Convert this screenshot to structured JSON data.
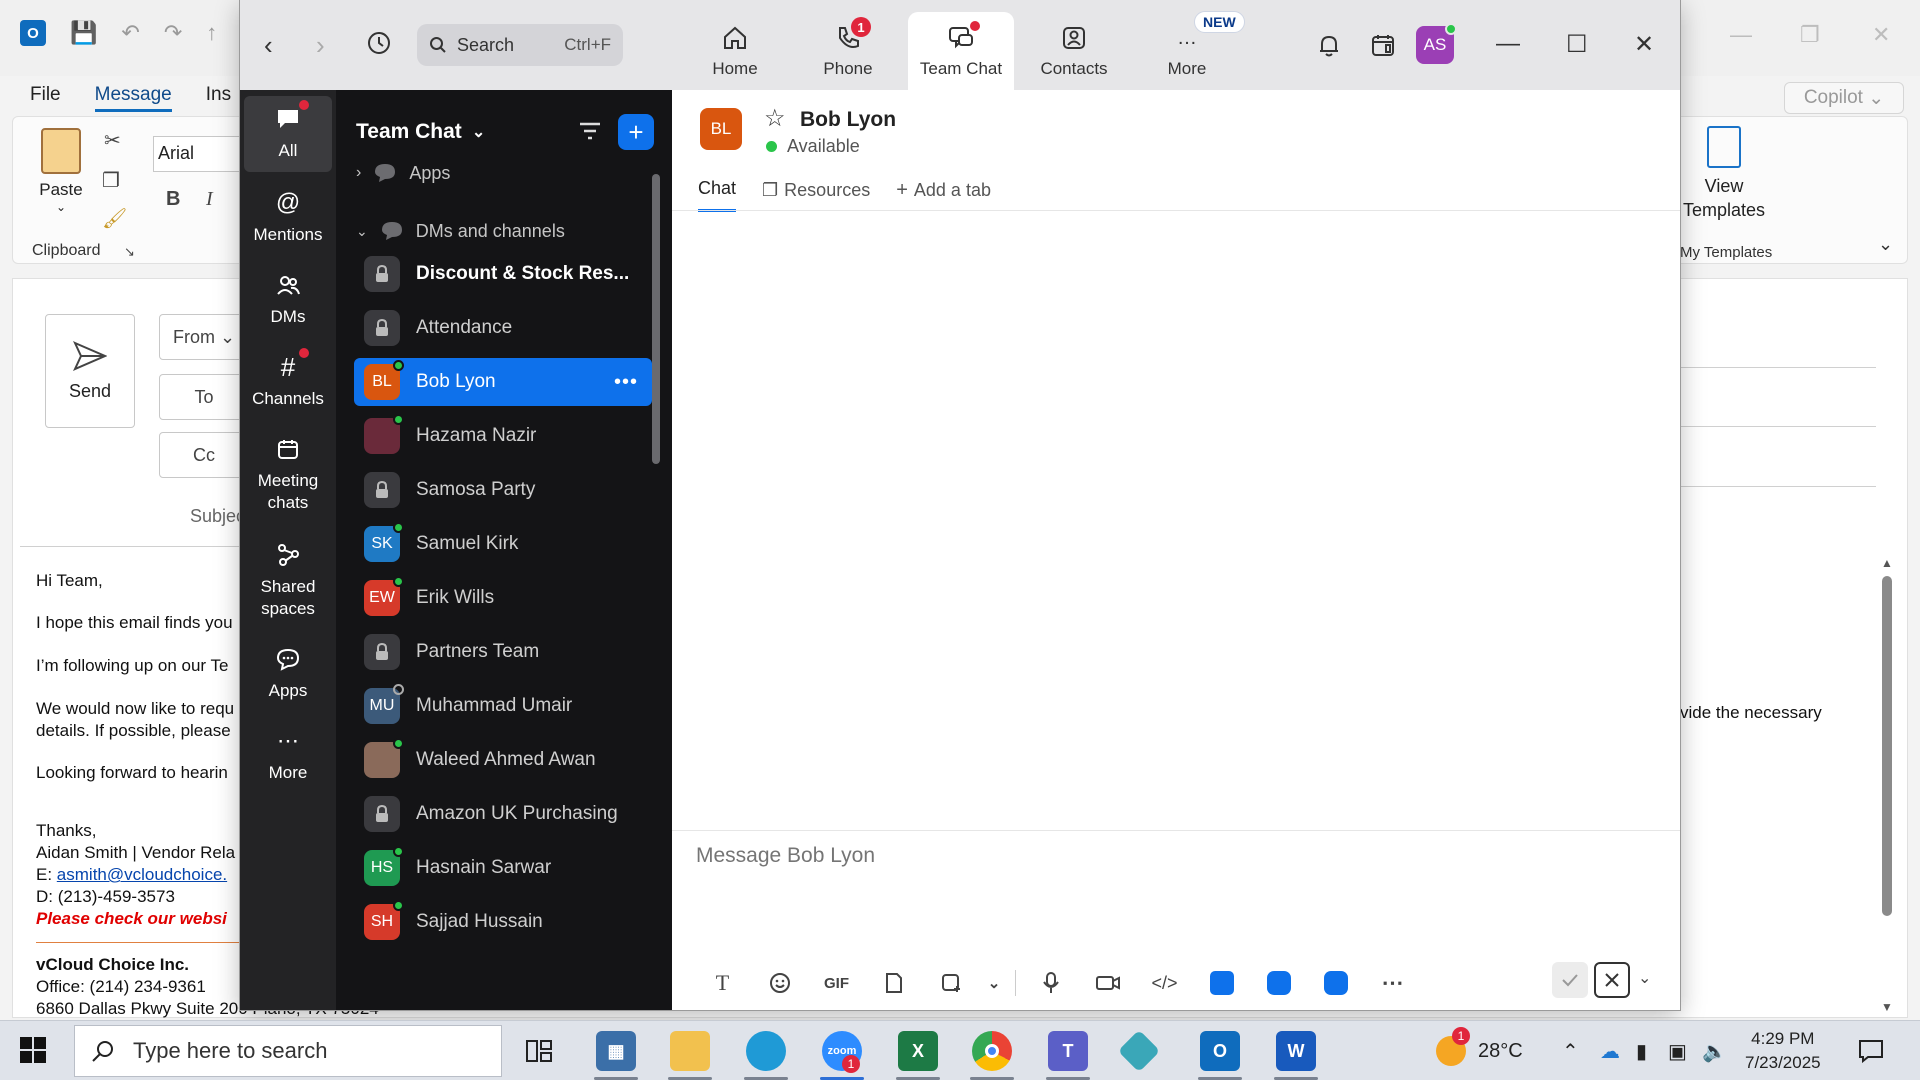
{
  "outlook": {
    "menu": [
      "File",
      "Message",
      "Ins"
    ],
    "copilot": "Copilot",
    "ribbon": {
      "paste": "Paste",
      "font": "Arial",
      "bold": "B",
      "italic": "I",
      "clipboard": "Clipboard",
      "view_templates": "View Templates",
      "my_templates": "My Templates"
    },
    "compose": {
      "send": "Send",
      "from": "From",
      "to": "To",
      "cc": "Cc",
      "subject": "Subjec"
    },
    "body": {
      "greeting": "Hi Team,",
      "line1": "I hope this email finds you",
      "line2": "I’m following up on our Te",
      "line3a": "We would now like to requ",
      "line3b": "details. If possible, please",
      "line3_right": "vide the necessary",
      "line4": "Looking forward to hearin",
      "thanks": "Thanks,",
      "sig_name": "Aidan Smith | Vendor Rela",
      "sig_email_label": "E: ",
      "sig_email": "asmith@vcloudchoice.",
      "sig_direct": "D: (213)-459-3573",
      "sig_check": "Please check our websi",
      "company": "vCloud Choice Inc.",
      "office": "Office: (214) 234-9361",
      "address": "6860 Dallas Pkwy Suite 200 Plano, TX 75024"
    }
  },
  "zoom": {
    "search": {
      "placeholder": "Search",
      "shortcut": "Ctrl+F"
    },
    "tabs": [
      {
        "label": "Home"
      },
      {
        "label": "Phone",
        "badge": "1"
      },
      {
        "label": "Team Chat"
      },
      {
        "label": "Contacts"
      },
      {
        "label": "More",
        "pill": "NEW"
      }
    ],
    "avatar": "AS",
    "rail": [
      "All",
      "Mentions",
      "DMs",
      "Channels",
      "Meeting chats",
      "Shared spaces",
      "Apps",
      "More"
    ],
    "panel": {
      "title": "Team Chat",
      "sections": {
        "apps": "Apps",
        "dms": "DMs and channels"
      },
      "items": [
        {
          "name": "Discount & Stock Res...",
          "type": "lock"
        },
        {
          "name": "Attendance",
          "type": "lock"
        },
        {
          "name": "Bob Lyon",
          "initials": "BL",
          "color": "#d9560f"
        },
        {
          "name": "Hazama Nazir",
          "initials": "",
          "color": "#6a2a3a"
        },
        {
          "name": "Samosa Party",
          "type": "lock"
        },
        {
          "name": "Samuel Kirk",
          "initials": "SK",
          "color": "#1f7ac4"
        },
        {
          "name": "Erik Wills",
          "initials": "EW",
          "color": "#d63a2a"
        },
        {
          "name": "Partners Team",
          "type": "lock"
        },
        {
          "name": "Muhammad Umair",
          "initials": "MU",
          "color": "#3c5a7a"
        },
        {
          "name": "Waleed Ahmed Awan",
          "initials": "",
          "color": "#8a6a5a"
        },
        {
          "name": "Amazon UK Purchasing",
          "type": "lock"
        },
        {
          "name": "Hasnain Sarwar",
          "initials": "HS",
          "color": "#1f9a52"
        },
        {
          "name": "Sajjad Hussain",
          "initials": "SH",
          "color": "#d63a2a"
        }
      ]
    },
    "chat": {
      "initials": "BL",
      "name": "Bob Lyon",
      "status": "Available",
      "tabs": [
        "Chat",
        "Resources",
        "Add a tab"
      ],
      "composer_placeholder": "Message Bob Lyon",
      "toolbar": {
        "gif": "GIF"
      }
    }
  },
  "taskbar": {
    "search_placeholder": "Type here to search",
    "temperature": "28°C",
    "time": "4:29 PM",
    "date": "7/23/2025",
    "zoom_badge": "1",
    "weather_badge": "1"
  },
  "colors": {
    "zoom_blue": "#0e71eb",
    "panel_bg": "#141416",
    "rail_bg": "#232325",
    "alert_red": "#e0263c",
    "online_green": "#2ac54a"
  }
}
